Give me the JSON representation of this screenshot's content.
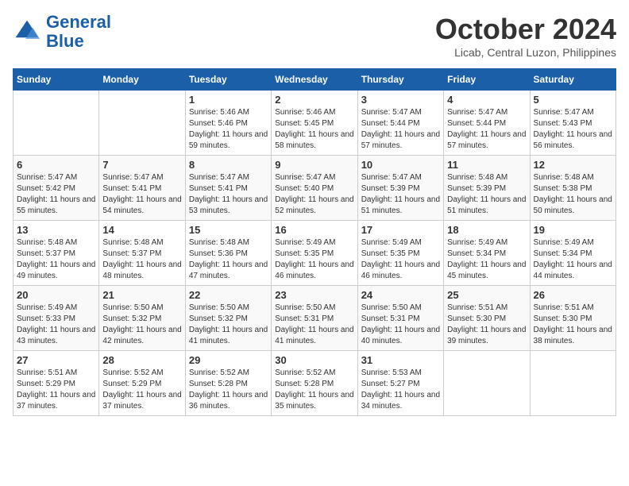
{
  "header": {
    "logo_line1": "General",
    "logo_line2": "Blue",
    "month": "October 2024",
    "location": "Licab, Central Luzon, Philippines"
  },
  "days_of_week": [
    "Sunday",
    "Monday",
    "Tuesday",
    "Wednesday",
    "Thursday",
    "Friday",
    "Saturday"
  ],
  "weeks": [
    [
      {
        "day": "",
        "info": ""
      },
      {
        "day": "",
        "info": ""
      },
      {
        "day": "1",
        "info": "Sunrise: 5:46 AM\nSunset: 5:46 PM\nDaylight: 11 hours and 59 minutes."
      },
      {
        "day": "2",
        "info": "Sunrise: 5:46 AM\nSunset: 5:45 PM\nDaylight: 11 hours and 58 minutes."
      },
      {
        "day": "3",
        "info": "Sunrise: 5:47 AM\nSunset: 5:44 PM\nDaylight: 11 hours and 57 minutes."
      },
      {
        "day": "4",
        "info": "Sunrise: 5:47 AM\nSunset: 5:44 PM\nDaylight: 11 hours and 57 minutes."
      },
      {
        "day": "5",
        "info": "Sunrise: 5:47 AM\nSunset: 5:43 PM\nDaylight: 11 hours and 56 minutes."
      }
    ],
    [
      {
        "day": "6",
        "info": "Sunrise: 5:47 AM\nSunset: 5:42 PM\nDaylight: 11 hours and 55 minutes."
      },
      {
        "day": "7",
        "info": "Sunrise: 5:47 AM\nSunset: 5:41 PM\nDaylight: 11 hours and 54 minutes."
      },
      {
        "day": "8",
        "info": "Sunrise: 5:47 AM\nSunset: 5:41 PM\nDaylight: 11 hours and 53 minutes."
      },
      {
        "day": "9",
        "info": "Sunrise: 5:47 AM\nSunset: 5:40 PM\nDaylight: 11 hours and 52 minutes."
      },
      {
        "day": "10",
        "info": "Sunrise: 5:47 AM\nSunset: 5:39 PM\nDaylight: 11 hours and 51 minutes."
      },
      {
        "day": "11",
        "info": "Sunrise: 5:48 AM\nSunset: 5:39 PM\nDaylight: 11 hours and 51 minutes."
      },
      {
        "day": "12",
        "info": "Sunrise: 5:48 AM\nSunset: 5:38 PM\nDaylight: 11 hours and 50 minutes."
      }
    ],
    [
      {
        "day": "13",
        "info": "Sunrise: 5:48 AM\nSunset: 5:37 PM\nDaylight: 11 hours and 49 minutes."
      },
      {
        "day": "14",
        "info": "Sunrise: 5:48 AM\nSunset: 5:37 PM\nDaylight: 11 hours and 48 minutes."
      },
      {
        "day": "15",
        "info": "Sunrise: 5:48 AM\nSunset: 5:36 PM\nDaylight: 11 hours and 47 minutes."
      },
      {
        "day": "16",
        "info": "Sunrise: 5:49 AM\nSunset: 5:35 PM\nDaylight: 11 hours and 46 minutes."
      },
      {
        "day": "17",
        "info": "Sunrise: 5:49 AM\nSunset: 5:35 PM\nDaylight: 11 hours and 46 minutes."
      },
      {
        "day": "18",
        "info": "Sunrise: 5:49 AM\nSunset: 5:34 PM\nDaylight: 11 hours and 45 minutes."
      },
      {
        "day": "19",
        "info": "Sunrise: 5:49 AM\nSunset: 5:34 PM\nDaylight: 11 hours and 44 minutes."
      }
    ],
    [
      {
        "day": "20",
        "info": "Sunrise: 5:49 AM\nSunset: 5:33 PM\nDaylight: 11 hours and 43 minutes."
      },
      {
        "day": "21",
        "info": "Sunrise: 5:50 AM\nSunset: 5:32 PM\nDaylight: 11 hours and 42 minutes."
      },
      {
        "day": "22",
        "info": "Sunrise: 5:50 AM\nSunset: 5:32 PM\nDaylight: 11 hours and 41 minutes."
      },
      {
        "day": "23",
        "info": "Sunrise: 5:50 AM\nSunset: 5:31 PM\nDaylight: 11 hours and 41 minutes."
      },
      {
        "day": "24",
        "info": "Sunrise: 5:50 AM\nSunset: 5:31 PM\nDaylight: 11 hours and 40 minutes."
      },
      {
        "day": "25",
        "info": "Sunrise: 5:51 AM\nSunset: 5:30 PM\nDaylight: 11 hours and 39 minutes."
      },
      {
        "day": "26",
        "info": "Sunrise: 5:51 AM\nSunset: 5:30 PM\nDaylight: 11 hours and 38 minutes."
      }
    ],
    [
      {
        "day": "27",
        "info": "Sunrise: 5:51 AM\nSunset: 5:29 PM\nDaylight: 11 hours and 37 minutes."
      },
      {
        "day": "28",
        "info": "Sunrise: 5:52 AM\nSunset: 5:29 PM\nDaylight: 11 hours and 37 minutes."
      },
      {
        "day": "29",
        "info": "Sunrise: 5:52 AM\nSunset: 5:28 PM\nDaylight: 11 hours and 36 minutes."
      },
      {
        "day": "30",
        "info": "Sunrise: 5:52 AM\nSunset: 5:28 PM\nDaylight: 11 hours and 35 minutes."
      },
      {
        "day": "31",
        "info": "Sunrise: 5:53 AM\nSunset: 5:27 PM\nDaylight: 11 hours and 34 minutes."
      },
      {
        "day": "",
        "info": ""
      },
      {
        "day": "",
        "info": ""
      }
    ]
  ]
}
